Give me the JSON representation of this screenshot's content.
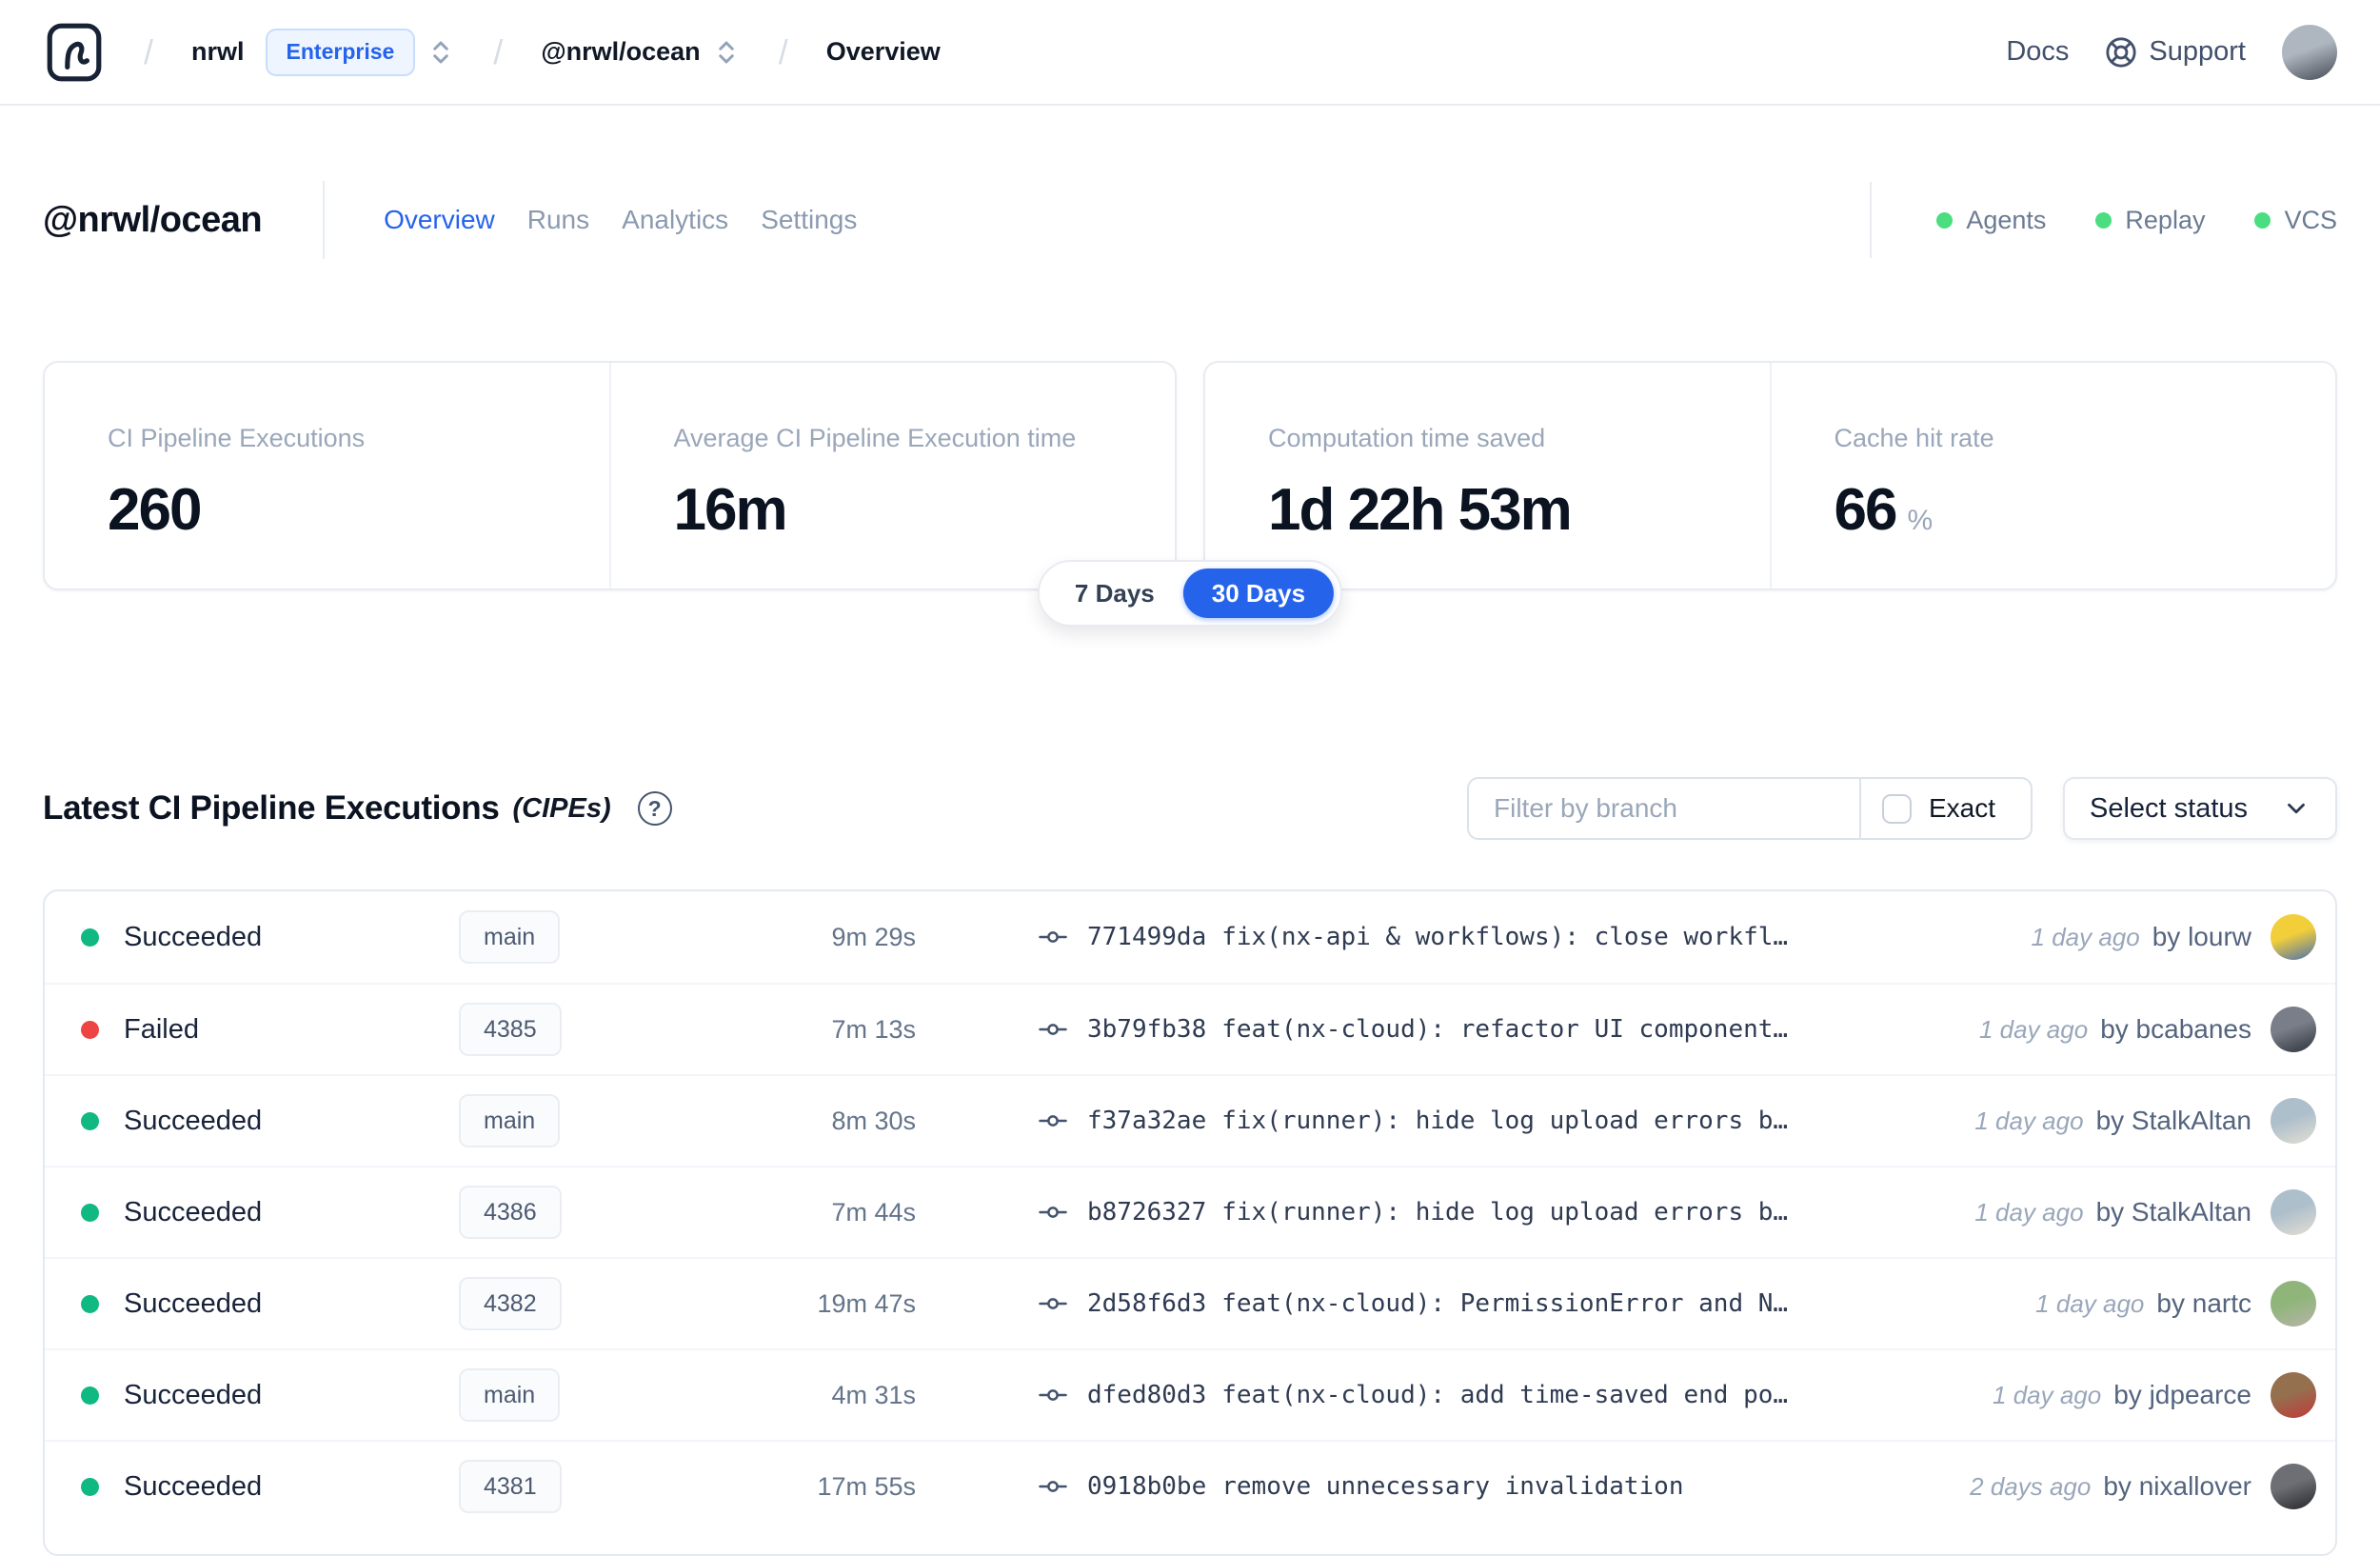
{
  "navbar": {
    "separator": "/",
    "org": "nrwl",
    "plan_badge": "Enterprise",
    "workspace": "@nrwl/ocean",
    "current_page": "Overview",
    "docs_label": "Docs",
    "support_label": "Support",
    "user_avatar_colors": [
      "#aeb6bf",
      "#454b55"
    ]
  },
  "workspace_header": {
    "title": "@nrwl/ocean",
    "tabs": [
      {
        "label": "Overview",
        "active": true
      },
      {
        "label": "Runs",
        "active": false
      },
      {
        "label": "Analytics",
        "active": false
      },
      {
        "label": "Settings",
        "active": false
      }
    ],
    "indicators": [
      {
        "label": "Agents",
        "color": "#4ade80"
      },
      {
        "label": "Replay",
        "color": "#4ade80"
      },
      {
        "label": "VCS",
        "color": "#4ade80"
      }
    ]
  },
  "stats": {
    "cards": [
      {
        "label": "CI Pipeline Executions",
        "value": "260",
        "suffix": ""
      },
      {
        "label": "Average CI Pipeline Execution time",
        "value": "16m",
        "suffix": ""
      },
      {
        "label": "Computation time saved",
        "value": "1d 22h 53m",
        "suffix": ""
      },
      {
        "label": "Cache hit rate",
        "value": "66",
        "suffix": "%"
      }
    ]
  },
  "range_toggle": {
    "accent": "#2563eb",
    "options": [
      {
        "label": "7 Days",
        "selected": false
      },
      {
        "label": "30 Days",
        "selected": true
      }
    ]
  },
  "cipe": {
    "title": "Latest CI Pipeline Executions",
    "subtitle": "(CIPEs)",
    "help_glyph": "?",
    "filter_placeholder": "Filter by branch",
    "exact_label": "Exact",
    "status_select_label": "Select status"
  },
  "table": {
    "rows": [
      {
        "status": "Succeeded",
        "status_color": "#10b981",
        "branch": "main",
        "duration": "9m 29s",
        "commit_hash": "771499da",
        "commit_message": "fix(nx-api & workflows): close workfl…",
        "time_ago": "1 day ago",
        "by_author": "by lourw",
        "avatar_colors": [
          "#f2cf3a",
          "#4a70b0"
        ]
      },
      {
        "status": "Failed",
        "status_color": "#ef4444",
        "branch": "4385",
        "duration": "7m 13s",
        "commit_hash": "3b79fb38",
        "commit_message": "feat(nx-cloud): refactor UI component…",
        "time_ago": "1 day ago",
        "by_author": "by bcabanes",
        "avatar_colors": [
          "#7a7e88",
          "#2e333c"
        ]
      },
      {
        "status": "Succeeded",
        "status_color": "#10b981",
        "branch": "main",
        "duration": "8m 30s",
        "commit_hash": "f37a32ae",
        "commit_message": "fix(runner): hide log upload errors b…",
        "time_ago": "1 day ago",
        "by_author": "by StalkAltan",
        "avatar_colors": [
          "#aebfcc",
          "#e3ded3"
        ]
      },
      {
        "status": "Succeeded",
        "status_color": "#10b981",
        "branch": "4386",
        "duration": "7m 44s",
        "commit_hash": "b8726327",
        "commit_message": "fix(runner): hide log upload errors b…",
        "time_ago": "1 day ago",
        "by_author": "by StalkAltan",
        "avatar_colors": [
          "#aebfcc",
          "#e3ded3"
        ]
      },
      {
        "status": "Succeeded",
        "status_color": "#10b981",
        "branch": "4382",
        "duration": "19m 47s",
        "commit_hash": "2d58f6d3",
        "commit_message": "feat(nx-cloud): PermissionError and N…",
        "time_ago": "1 day ago",
        "by_author": "by nartc",
        "avatar_colors": [
          "#8fb57a",
          "#b8b4a9"
        ]
      },
      {
        "status": "Succeeded",
        "status_color": "#10b981",
        "branch": "main",
        "duration": "4m 31s",
        "commit_hash": "dfed80d3",
        "commit_message": "feat(nx-cloud): add time-saved end po…",
        "time_ago": "1 day ago",
        "by_author": "by jdpearce",
        "avatar_colors": [
          "#95704f",
          "#c03a3a"
        ]
      },
      {
        "status": "Succeeded",
        "status_color": "#10b981",
        "branch": "4381",
        "duration": "17m 55s",
        "commit_hash": "0918b0be",
        "commit_message": "remove unnecessary invalidation",
        "time_ago": "2 days ago",
        "by_author": "by nixallover",
        "avatar_colors": [
          "#6d6f75",
          "#26272c"
        ]
      }
    ]
  }
}
